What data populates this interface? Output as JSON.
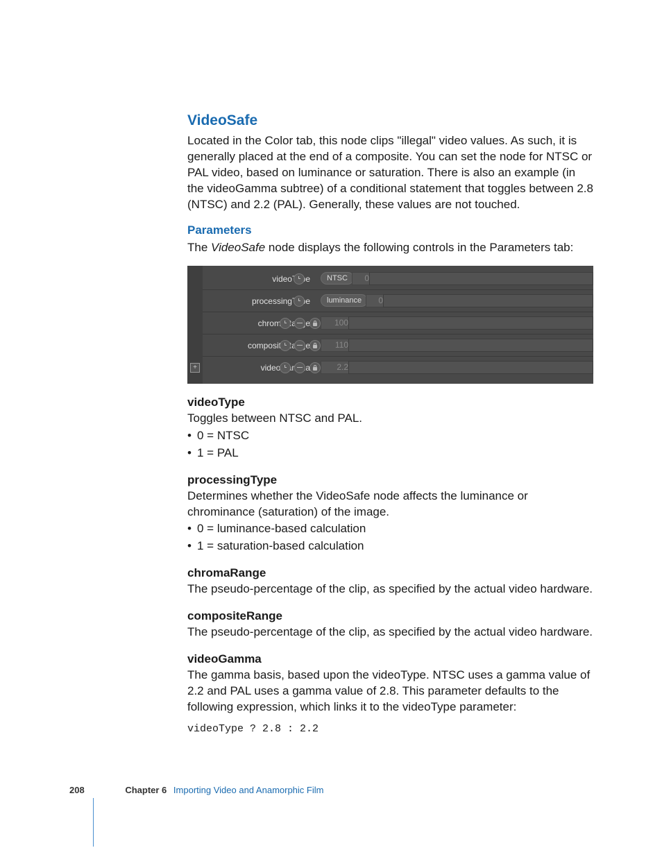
{
  "section_title": "VideoSafe",
  "intro": "Located in the Color tab, this node clips \"illegal\" video values. As such, it is generally placed at the end of a composite. You can set the node for NTSC or PAL video, based on luminance or saturation. There is also an example (in the videoGamma subtree) of a conditional statement that toggles between 2.8 (NTSC) and 2.2 (PAL). Generally, these values are not touched.",
  "params_heading": "Parameters",
  "params_intro_pre": "The ",
  "params_intro_node": "VideoSafe",
  "params_intro_post": " node displays the following controls in the Parameters tab:",
  "ui": {
    "rows": {
      "videoType": {
        "label": "videoType",
        "pill": "NTSC",
        "pillLeft": 170,
        "value": "0",
        "valLeft": 215,
        "valW": 20,
        "trackLeft": 240,
        "icons": [
          "clock"
        ],
        "iconsLeft": 130
      },
      "processingType": {
        "label": "processingType",
        "pill": "luminance",
        "pillLeft": 170,
        "value": "0",
        "valLeft": 235,
        "valW": 20,
        "trackLeft": 260,
        "icons": [
          "clock"
        ],
        "iconsLeft": 130
      },
      "chromaRange": {
        "label": "chromaRange",
        "value": "100",
        "valLeft": 170,
        "valW": 35,
        "trackLeft": 210,
        "icons": [
          "clock",
          "key",
          "lock"
        ],
        "iconsLeft": 110
      },
      "compositeRange": {
        "label": "compositeRange",
        "value": "110",
        "valLeft": 170,
        "valW": 35,
        "trackLeft": 210,
        "icons": [
          "clock",
          "key",
          "lock"
        ],
        "iconsLeft": 110
      },
      "videoGamma": {
        "label": "videoGamma",
        "value": "2.2",
        "valLeft": 170,
        "valW": 35,
        "trackLeft": 210,
        "icons": [
          "clock",
          "key",
          "lock"
        ],
        "iconsLeft": 110
      }
    },
    "plus": "+"
  },
  "param_docs": {
    "videoType": {
      "name": "videoType",
      "desc": "Toggles between NTSC and PAL.",
      "bullets": [
        "0 = NTSC",
        "1 = PAL"
      ]
    },
    "processingType": {
      "name": "processingType",
      "desc": "Determines whether the VideoSafe node affects the luminance or chrominance (saturation) of the image.",
      "bullets": [
        "0 = luminance-based calculation",
        "1 = saturation-based calculation"
      ]
    },
    "chromaRange": {
      "name": "chromaRange",
      "desc": "The pseudo-percentage of the clip, as specified by the actual video hardware."
    },
    "compositeRange": {
      "name": "compositeRange",
      "desc": "The pseudo-percentage of the clip, as specified by the actual video hardware."
    },
    "videoGamma": {
      "name": "videoGamma",
      "desc": "The gamma basis, based upon the videoType. NTSC uses a gamma value of 2.2 and PAL uses a gamma value of 2.8. This parameter defaults to the following expression, which links it to the videoType parameter:",
      "code": "videoType ? 2.8 : 2.2"
    }
  },
  "footer": {
    "page": "208",
    "chapter": "Chapter 6",
    "title": "Importing Video and Anamorphic Film"
  }
}
